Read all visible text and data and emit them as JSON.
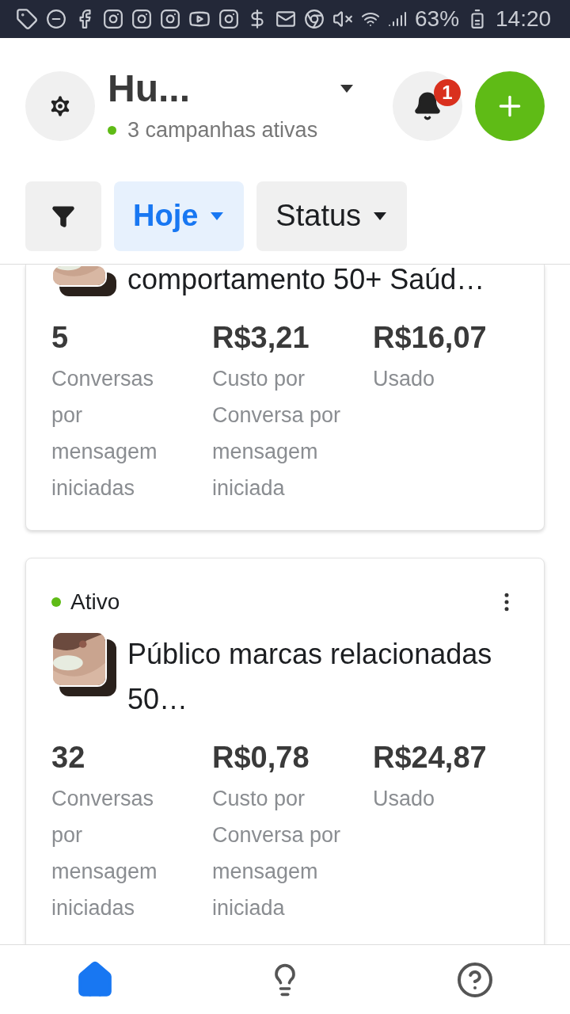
{
  "status_bar": {
    "battery": "63%",
    "time": "14:20"
  },
  "header": {
    "account": "Hu...",
    "subtitle": "3 campanhas ativas",
    "notifications": "1"
  },
  "filters": [
    {
      "label": "Hoje",
      "selected": true
    },
    {
      "label": "Status",
      "selected": false
    }
  ],
  "campaigns": [
    {
      "title": "comportamento 50+ Saúd…",
      "metrics": [
        {
          "value": "5",
          "label": "Conversas por mensagem iniciadas"
        },
        {
          "value": "R$3,21",
          "label": "Custo por Conversa por mensagem iniciada"
        },
        {
          "value": "R$16,07",
          "label": "Usado"
        }
      ]
    },
    {
      "status": "Ativo",
      "title": "Público marcas relacionadas 50…",
      "metrics": [
        {
          "value": "32",
          "label": "Conversas por mensagem iniciadas"
        },
        {
          "value": "R$0,78",
          "label": "Custo por Conversa por mensagem iniciada"
        },
        {
          "value": "R$24,87",
          "label": "Usado"
        }
      ]
    }
  ],
  "bottom_nav": [
    {
      "kind": "home",
      "selected": true
    },
    {
      "kind": "ideas",
      "selected": false
    },
    {
      "kind": "help",
      "selected": false
    }
  ]
}
